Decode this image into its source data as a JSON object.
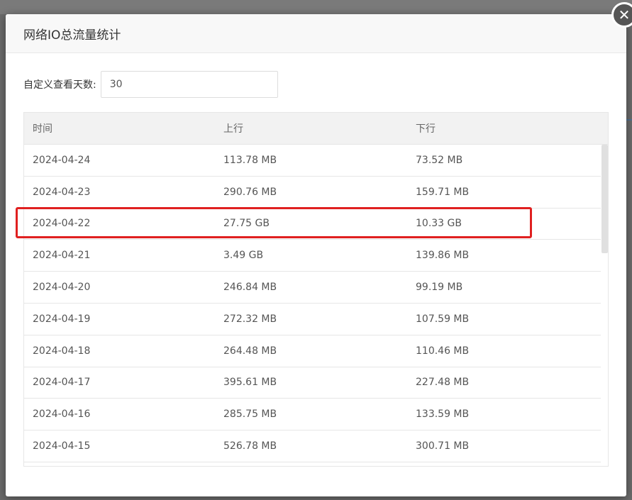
{
  "dialog": {
    "title": "网络IO总流量统计",
    "close_icon": "close-icon"
  },
  "filter": {
    "label": "自定义查看天数:",
    "value": "30"
  },
  "table": {
    "headers": [
      "时间",
      "上行",
      "下行"
    ],
    "rows": [
      [
        "2024-04-24",
        "113.78 MB",
        "73.52 MB"
      ],
      [
        "2024-04-23",
        "290.76 MB",
        "159.71 MB"
      ],
      [
        "2024-04-22",
        "27.75 GB",
        "10.33 GB"
      ],
      [
        "2024-04-21",
        "3.49 GB",
        "139.86 MB"
      ],
      [
        "2024-04-20",
        "246.84 MB",
        "99.19 MB"
      ],
      [
        "2024-04-19",
        "272.32 MB",
        "107.59 MB"
      ],
      [
        "2024-04-18",
        "264.48 MB",
        "110.46 MB"
      ],
      [
        "2024-04-17",
        "395.61 MB",
        "227.48 MB"
      ],
      [
        "2024-04-16",
        "285.75 MB",
        "133.59 MB"
      ],
      [
        "2024-04-15",
        "526.78 MB",
        "300.71 MB"
      ]
    ]
  },
  "highlight_color": "#e02020"
}
